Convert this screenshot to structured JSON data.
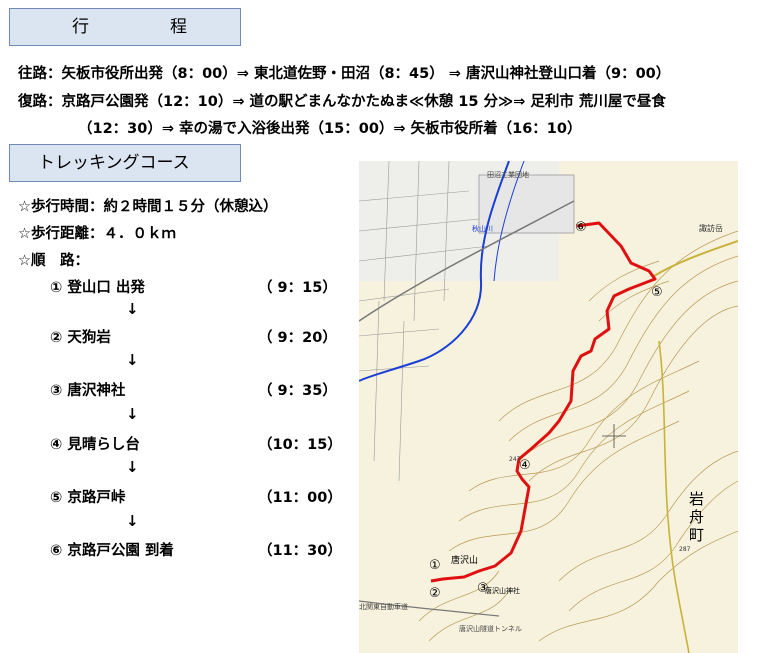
{
  "itinerary": {
    "heading": [
      "行",
      "程"
    ],
    "outbound": "往路：矢板市役所出発（8：00）⇒ 東北道佐野・田沼（8：45） ⇒ 唐沢山神社登山口着（9：00）",
    "return_1": "復路：京路戸公園発（12：10）⇒ 道の駅どまんなかたぬま≪休憩 15 分≫⇒ 足利市 荒川屋で昼食",
    "return_2": "（12：30）⇒ 幸の湯で入浴後出発（15：00）⇒ 矢板市役所着（16：10）"
  },
  "course": {
    "heading": "トレッキングコース",
    "walking_time": "☆歩行時間：約２時間１５分（休憩込）",
    "distance": "☆歩行距離：４．０ｋｍ",
    "route_label": "☆順　路：",
    "steps": [
      {
        "label": "① 登山口 出発",
        "time": "（ 9：15）"
      },
      {
        "label": "② 天狗岩",
        "time": "（ 9：20）"
      },
      {
        "label": "③ 唐沢神社",
        "time": "（ 9：35）"
      },
      {
        "label": "④ 見晴らし台",
        "time": "（10：15）"
      },
      {
        "label": "⑤ 京路戸峠",
        "time": "（11：00）"
      },
      {
        "label": "⑥ 京路戸公園 到着",
        "time": "（11：30）"
      }
    ],
    "arrow": "↓"
  },
  "map": {
    "place_town": [
      "岩",
      "舟",
      "町"
    ],
    "mountain": "唐沢山",
    "shrine": "唐沢山神社",
    "markers": [
      "①",
      "②",
      "③",
      "④",
      "⑤",
      "⑥"
    ],
    "road_label": "北関東自動車道",
    "tunnel_label": "唐沢山隧道トンネル",
    "industrial": "田沼工業団地",
    "river": "秋山川",
    "peak": "諏訪岳",
    "elev_1": "247",
    "elev_2": "287",
    "colors": {
      "route": "#e01010",
      "river": "#1a3fd6",
      "contour": "#b08a3c",
      "map_bg": "#f6f2de"
    }
  }
}
